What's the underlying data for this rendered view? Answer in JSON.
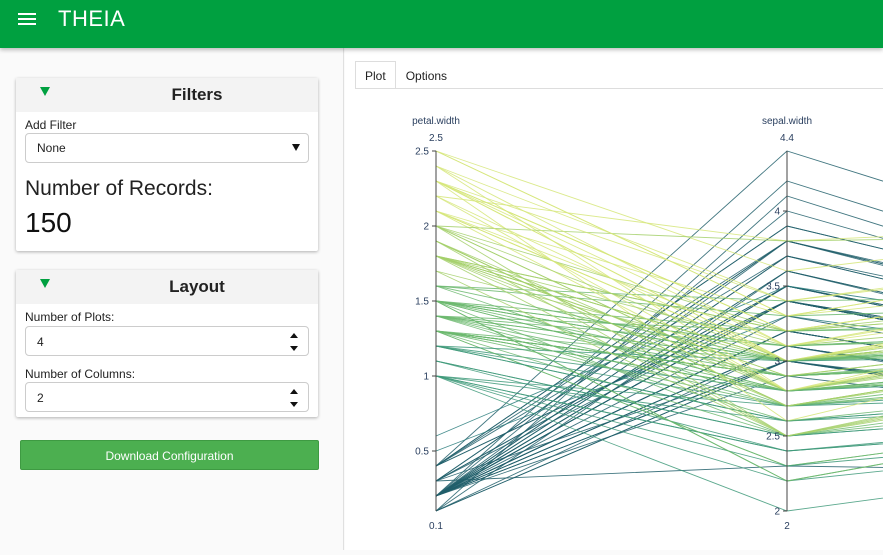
{
  "app": {
    "title": "THEIA",
    "menu_icon": "menu-icon"
  },
  "filters": {
    "title": "Filters",
    "add_filter_label": "Add Filter",
    "add_filter_value": "None",
    "records_label": "Number of Records:",
    "records_count": "150"
  },
  "layout": {
    "title": "Layout",
    "plots_label": "Number of Plots:",
    "plots_value": "4",
    "columns_label": "Number of Columns:",
    "columns_value": "2"
  },
  "download_label": "Download Configuration",
  "tabs": [
    {
      "label": "Plot",
      "active": true
    },
    {
      "label": "Options",
      "active": false
    }
  ],
  "chart_data": {
    "type": "parallel-coordinates",
    "colorscale": [
      "#215f6b",
      "#2a7c7c",
      "#3f9a7a",
      "#6cb86f",
      "#a4d06b",
      "#d6e67a"
    ],
    "dimensions": [
      {
        "label": "petal.width",
        "range": [
          0.1,
          2.5
        ],
        "range_labels": [
          "0.1",
          "2.5"
        ],
        "ticks": [
          0.5,
          1,
          1.5,
          2,
          2.5
        ],
        "tick_labels": [
          "0.5",
          "1",
          "1.5",
          "2",
          "2.5"
        ]
      },
      {
        "label": "sepal.width",
        "range": [
          2,
          4.4
        ],
        "range_labels": [
          "2",
          "4.4"
        ],
        "ticks": [
          2,
          2.5,
          3,
          3.5,
          4
        ],
        "tick_labels": [
          "2",
          "2.5",
          "3",
          "3.5",
          "4"
        ]
      }
    ],
    "lines": [
      [
        0.2,
        3.5
      ],
      [
        0.2,
        3.0
      ],
      [
        0.2,
        3.2
      ],
      [
        0.2,
        3.1
      ],
      [
        0.2,
        3.6
      ],
      [
        0.4,
        3.9
      ],
      [
        0.3,
        3.4
      ],
      [
        0.2,
        3.4
      ],
      [
        0.2,
        2.9
      ],
      [
        0.1,
        3.1
      ],
      [
        0.2,
        3.7
      ],
      [
        0.2,
        3.4
      ],
      [
        0.1,
        3.0
      ],
      [
        0.1,
        3.0
      ],
      [
        0.2,
        4.0
      ],
      [
        0.4,
        4.4
      ],
      [
        0.4,
        3.9
      ],
      [
        0.3,
        3.5
      ],
      [
        0.3,
        3.8
      ],
      [
        0.3,
        3.8
      ],
      [
        0.2,
        3.4
      ],
      [
        0.4,
        3.7
      ],
      [
        0.2,
        3.6
      ],
      [
        0.5,
        3.3
      ],
      [
        0.2,
        3.4
      ],
      [
        0.2,
        3.0
      ],
      [
        0.4,
        3.4
      ],
      [
        0.2,
        3.5
      ],
      [
        0.2,
        3.4
      ],
      [
        0.2,
        3.2
      ],
      [
        0.2,
        3.1
      ],
      [
        0.4,
        3.4
      ],
      [
        0.1,
        4.1
      ],
      [
        0.2,
        4.2
      ],
      [
        0.2,
        3.1
      ],
      [
        0.2,
        3.2
      ],
      [
        0.2,
        3.5
      ],
      [
        0.1,
        3.6
      ],
      [
        0.2,
        3.0
      ],
      [
        0.2,
        3.4
      ],
      [
        0.3,
        3.5
      ],
      [
        0.3,
        2.3
      ],
      [
        0.2,
        3.2
      ],
      [
        0.6,
        3.5
      ],
      [
        0.4,
        3.8
      ],
      [
        0.3,
        3.0
      ],
      [
        0.2,
        3.8
      ],
      [
        0.2,
        3.2
      ],
      [
        0.2,
        3.7
      ],
      [
        0.2,
        3.3
      ],
      [
        1.4,
        3.2
      ],
      [
        1.5,
        3.2
      ],
      [
        1.5,
        3.1
      ],
      [
        1.3,
        2.3
      ],
      [
        1.5,
        2.8
      ],
      [
        1.3,
        2.8
      ],
      [
        1.6,
        3.3
      ],
      [
        1.0,
        2.4
      ],
      [
        1.3,
        2.9
      ],
      [
        1.4,
        2.7
      ],
      [
        1.0,
        2.0
      ],
      [
        1.5,
        3.0
      ],
      [
        1.0,
        2.2
      ],
      [
        1.4,
        2.9
      ],
      [
        1.3,
        2.9
      ],
      [
        1.4,
        3.1
      ],
      [
        1.5,
        3.0
      ],
      [
        1.0,
        2.7
      ],
      [
        1.5,
        2.2
      ],
      [
        1.1,
        2.5
      ],
      [
        1.8,
        3.2
      ],
      [
        1.3,
        2.8
      ],
      [
        1.5,
        2.5
      ],
      [
        1.2,
        2.8
      ],
      [
        1.3,
        2.9
      ],
      [
        1.4,
        3.0
      ],
      [
        1.4,
        2.8
      ],
      [
        1.7,
        3.0
      ],
      [
        1.5,
        2.9
      ],
      [
        1.0,
        2.6
      ],
      [
        1.1,
        2.4
      ],
      [
        1.0,
        2.4
      ],
      [
        1.2,
        2.7
      ],
      [
        1.6,
        2.7
      ],
      [
        1.5,
        3.0
      ],
      [
        1.6,
        3.4
      ],
      [
        1.5,
        3.1
      ],
      [
        1.3,
        2.3
      ],
      [
        1.3,
        3.0
      ],
      [
        1.3,
        2.5
      ],
      [
        1.2,
        2.6
      ],
      [
        1.4,
        3.0
      ],
      [
        1.2,
        2.6
      ],
      [
        1.0,
        2.3
      ],
      [
        1.3,
        2.7
      ],
      [
        1.2,
        3.0
      ],
      [
        1.3,
        2.9
      ],
      [
        1.3,
        2.9
      ],
      [
        1.1,
        2.5
      ],
      [
        1.3,
        2.8
      ],
      [
        2.5,
        3.3
      ],
      [
        1.9,
        2.7
      ],
      [
        2.1,
        3.0
      ],
      [
        1.8,
        2.9
      ],
      [
        2.2,
        3.0
      ],
      [
        2.1,
        3.0
      ],
      [
        1.7,
        2.5
      ],
      [
        1.8,
        2.9
      ],
      [
        1.8,
        2.5
      ],
      [
        2.5,
        3.6
      ],
      [
        2.0,
        3.2
      ],
      [
        1.9,
        2.7
      ],
      [
        2.1,
        3.0
      ],
      [
        2.0,
        2.5
      ],
      [
        2.4,
        2.8
      ],
      [
        2.3,
        3.2
      ],
      [
        1.8,
        3.0
      ],
      [
        2.2,
        3.8
      ],
      [
        2.3,
        2.6
      ],
      [
        1.5,
        2.2
      ],
      [
        2.3,
        3.2
      ],
      [
        2.0,
        2.8
      ],
      [
        2.0,
        2.8
      ],
      [
        1.8,
        2.7
      ],
      [
        2.1,
        3.3
      ],
      [
        1.8,
        3.2
      ],
      [
        1.8,
        2.8
      ],
      [
        1.8,
        3.0
      ],
      [
        2.1,
        2.8
      ],
      [
        1.6,
        3.0
      ],
      [
        1.9,
        2.8
      ],
      [
        2.0,
        3.8
      ],
      [
        2.2,
        2.8
      ],
      [
        1.5,
        2.8
      ],
      [
        1.4,
        2.6
      ],
      [
        2.3,
        3.0
      ],
      [
        2.4,
        3.4
      ],
      [
        1.8,
        3.1
      ],
      [
        1.8,
        3.0
      ],
      [
        2.1,
        3.1
      ],
      [
        2.4,
        3.1
      ],
      [
        2.3,
        3.1
      ],
      [
        1.9,
        2.7
      ],
      [
        2.3,
        3.2
      ],
      [
        2.5,
        3.3
      ],
      [
        2.3,
        3.0
      ],
      [
        1.9,
        2.5
      ],
      [
        2.0,
        3.0
      ],
      [
        2.3,
        3.4
      ],
      [
        1.8,
        3.0
      ]
    ]
  }
}
